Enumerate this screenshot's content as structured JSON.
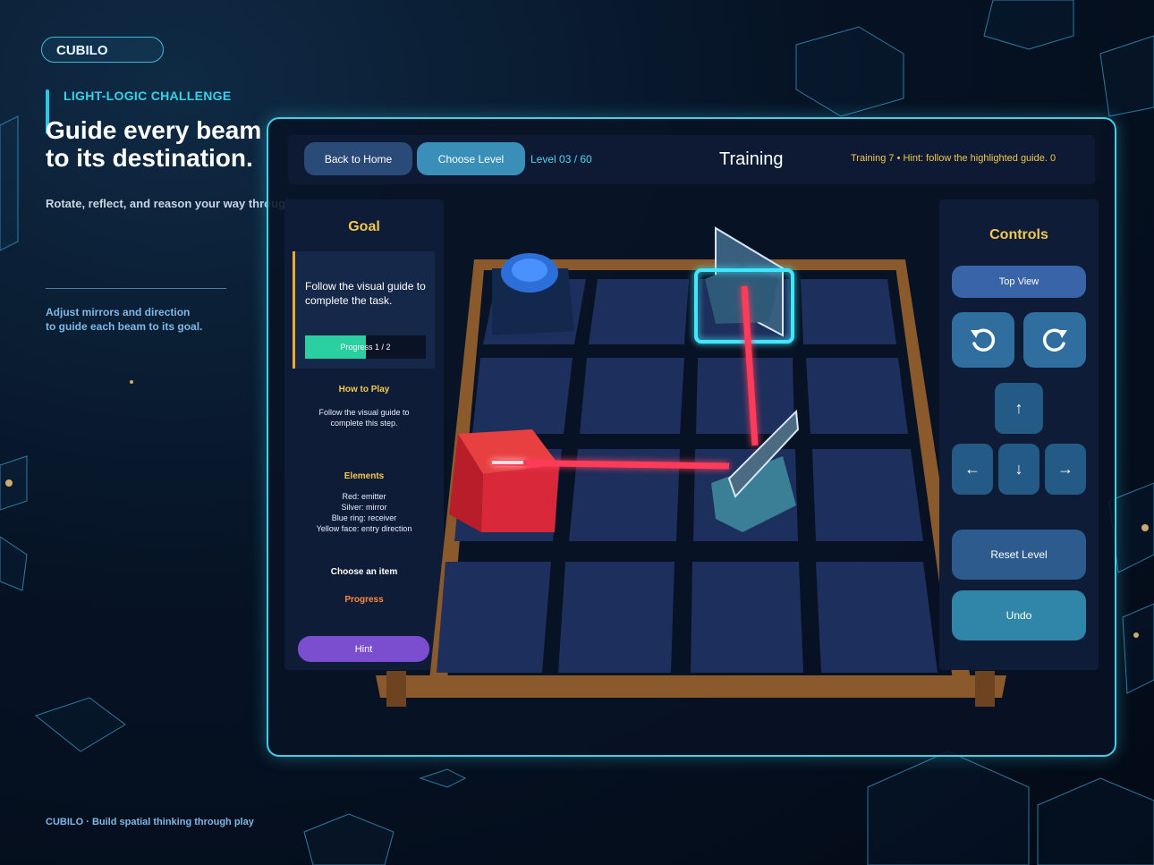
{
  "brand": {
    "name": "CUBILO"
  },
  "intro": {
    "kicker": "LIGHT-LOGIC CHALLENGE",
    "headline_line1": "Guide every beam",
    "headline_line2": "to its destination.",
    "subline": "Rotate, reflect, and reason your way through space.",
    "note_line1": "Adjust mirrors and direction",
    "note_line2": "to guide each beam to its goal.",
    "footer": "CUBILO · Build spatial thinking through play"
  },
  "topbar": {
    "back_label": "Back to Home",
    "choose_label": "Choose Level",
    "level_text": "Level 03 / 60",
    "title": "Training",
    "hint": "Training 7  •  Hint: follow the highlighted guide. 0"
  },
  "goal": {
    "title": "Goal",
    "task": "Follow the visual guide to complete the task.",
    "progress_label": "Progress 1 / 2",
    "progress_fraction": 0.5,
    "how_title": "How to Play",
    "how_line1": "Follow the visual guide to",
    "how_line2": "complete this step.",
    "elements_title": "Elements",
    "elements": [
      "Red: emitter",
      "Silver: mirror",
      "Blue ring: receiver",
      "Yellow face: entry direction"
    ],
    "choose_item": "Choose an item",
    "progress_word": "Progress",
    "hint_button": "Hint"
  },
  "controls": {
    "title": "Controls",
    "top_view": "Top View",
    "up": "↑",
    "left": "←",
    "down": "↓",
    "right": "→",
    "reset": "Reset Level",
    "undo": "Undo"
  },
  "colors": {
    "accent": "#3fd0ea",
    "gold": "#f2c94c",
    "beam": "#ff3a5a",
    "hint_purple": "#7b4ed0",
    "progress_green": "#2ad0a0"
  }
}
